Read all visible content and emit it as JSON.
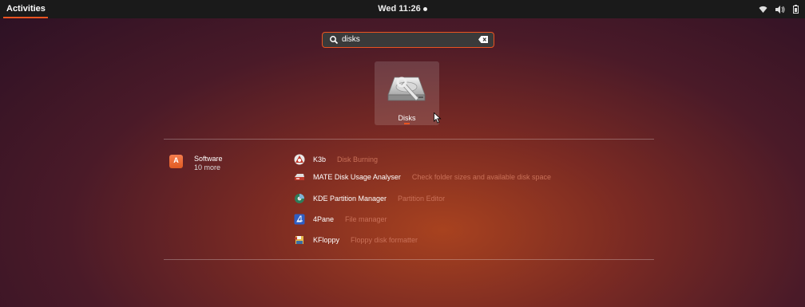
{
  "topbar": {
    "activities_label": "Activities",
    "clock": "Wed 11:26",
    "tray_icons": [
      "wifi-icon",
      "volume-icon",
      "battery-icon"
    ]
  },
  "search": {
    "value": "disks",
    "icon": "search-icon",
    "clear_icon": "clear-icon"
  },
  "app_result": {
    "label": "Disks",
    "icon": "disks-icon"
  },
  "provider": {
    "name": "Software",
    "more": "10 more",
    "icon": "software-center-icon",
    "icon_letter": "A"
  },
  "results": [
    {
      "name": "K3b",
      "desc": "Disk Burning",
      "icon": "k3b-icon"
    },
    {
      "name": "MATE Disk Usage Analyser",
      "desc": "Check folder sizes and available disk space",
      "icon": "disk-usage-icon"
    },
    {
      "name": "KDE Partition Manager",
      "desc": "Partition Editor",
      "icon": "partition-manager-icon"
    },
    {
      "name": "4Pane",
      "desc": "File manager",
      "icon": "4pane-icon"
    },
    {
      "name": "KFloppy",
      "desc": "Floppy disk formatter",
      "icon": "kfloppy-icon"
    }
  ],
  "colors": {
    "accent": "#e95420",
    "topbar": "#1a1a1a",
    "desc_text": "#c87058"
  }
}
